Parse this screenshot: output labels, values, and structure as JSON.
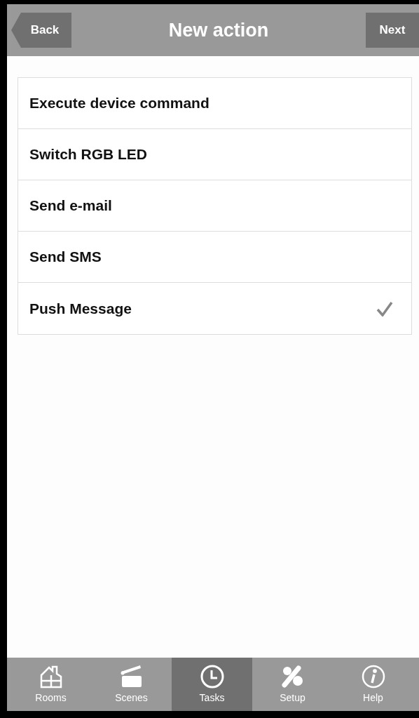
{
  "header": {
    "back": "Back",
    "title": "New action",
    "next": "Next"
  },
  "actions": [
    {
      "label": "Execute device command",
      "selected": false
    },
    {
      "label": "Switch RGB LED",
      "selected": false
    },
    {
      "label": "Send e-mail",
      "selected": false
    },
    {
      "label": "Send SMS",
      "selected": false
    },
    {
      "label": "Push Message",
      "selected": true
    }
  ],
  "tabs": [
    {
      "label": "Rooms",
      "selected": false
    },
    {
      "label": "Scenes",
      "selected": false
    },
    {
      "label": "Tasks",
      "selected": true
    },
    {
      "label": "Setup",
      "selected": false
    },
    {
      "label": "Help",
      "selected": false
    }
  ]
}
